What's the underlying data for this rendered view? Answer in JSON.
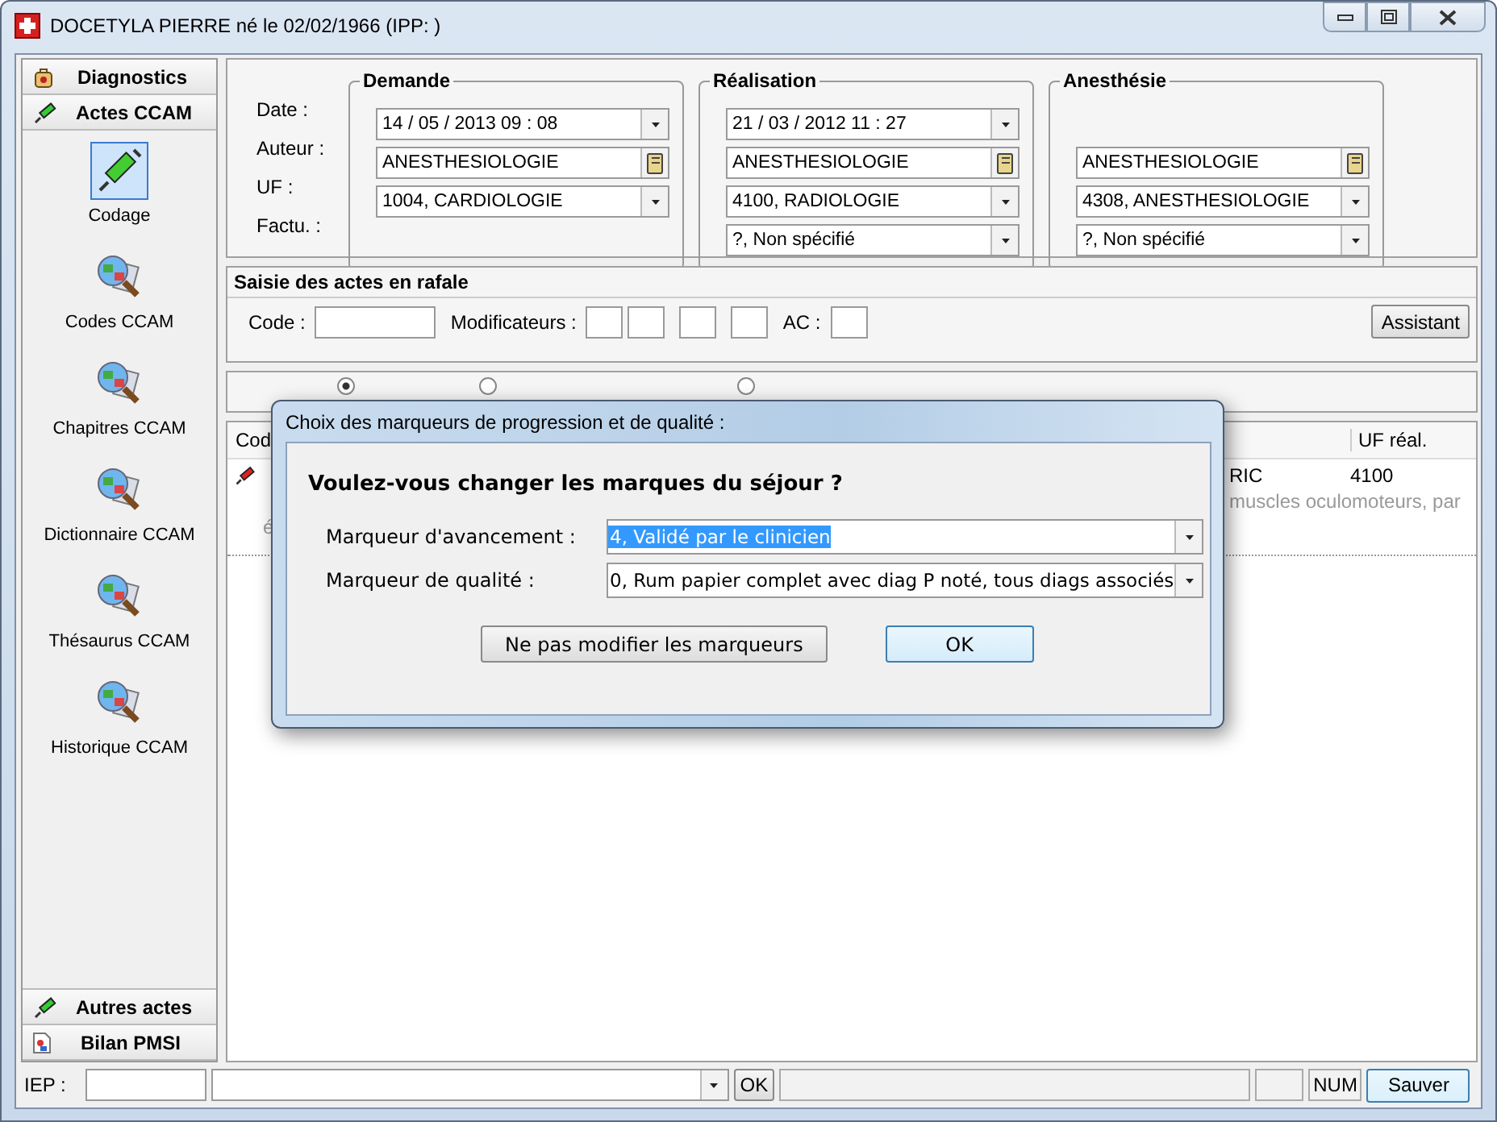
{
  "window": {
    "title": "DOCETYLA PIERRE né le 02/02/1966 (IPP: )"
  },
  "sidebar": {
    "top_items": [
      {
        "label": "Diagnostics",
        "kind": "bag"
      },
      {
        "label": "Actes CCAM",
        "kind": "syringe"
      }
    ],
    "tools": [
      {
        "label": "Codage",
        "kind": "syringe",
        "selected": true
      },
      {
        "label": "Codes CCAM",
        "kind": "magnifier",
        "selected": false
      },
      {
        "label": "Chapitres CCAM",
        "kind": "magnifier",
        "selected": false
      },
      {
        "label": "Dictionnaire CCAM",
        "kind": "magnifier",
        "selected": false
      },
      {
        "label": "Thésaurus CCAM",
        "kind": "magnifier",
        "selected": false
      },
      {
        "label": "Historique CCAM",
        "kind": "magnifier",
        "selected": false
      }
    ],
    "bottom_items": [
      {
        "label": "Autres actes",
        "kind": "syringe"
      },
      {
        "label": "Bilan PMSI",
        "kind": "document"
      }
    ]
  },
  "form": {
    "row_labels": [
      "Date :",
      "Auteur :",
      "UF :",
      "Factu. :"
    ],
    "groups": [
      {
        "title": "Demande",
        "date": {
          "kind": "dropdown",
          "value": "14 / 05 / 2013   09 : 08"
        },
        "author": {
          "kind": "lookup",
          "value": "ANESTHESIOLOGIE"
        },
        "uf": {
          "kind": "dropdown",
          "value": "1004, CARDIOLOGIE"
        }
      },
      {
        "title": "Réalisation",
        "date": {
          "kind": "dropdown",
          "value": "21 / 03 / 2012   11 : 27"
        },
        "author": {
          "kind": "lookup",
          "value": "ANESTHESIOLOGIE"
        },
        "uf": {
          "kind": "dropdown",
          "value": "4100, RADIOLOGIE"
        },
        "factu": {
          "kind": "dropdown",
          "value": "?, Non spécifié"
        }
      },
      {
        "title": "Anesthésie",
        "author": {
          "kind": "lookup",
          "value": "ANESTHESIOLOGIE"
        },
        "uf": {
          "kind": "dropdown",
          "value": "4308, ANESTHESIOLOGIE"
        },
        "factu": {
          "kind": "dropdown",
          "value": "?, Non spécifié"
        }
      }
    ]
  },
  "rafale": {
    "title": "Saisie des actes en rafale",
    "code_label": "Code :",
    "modifiers_label": "Modificateurs :",
    "ac_label": "AC :",
    "assistant_button": "Assistant"
  },
  "sort_options": [
    {
      "selected": true
    },
    {
      "selected": false
    },
    {
      "selected": false
    }
  ],
  "table": {
    "columns": [
      "Cod",
      "UF réal."
    ],
    "rows": [
      {
        "line_3": "é",
        "column_3": "RIC",
        "description": "muscles oculomoteurs, par",
        "uf": "4100"
      }
    ]
  },
  "dialog": {
    "title": "Choix des marqueurs de progression et de qualité :",
    "question": "Voulez-vous changer les marques du séjour ?",
    "fields": [
      {
        "label": "Marqueur d'avancement :",
        "value": "4, Validé par le clinicien",
        "text_selected": true
      },
      {
        "label": "Marqueur de qualité :",
        "value": "0, Rum papier complet avec diag P noté, tous diags associés",
        "text_selected": false
      }
    ],
    "buttons": [
      {
        "label": "Ne pas modifier les marqueurs",
        "default": false
      },
      {
        "label": "OK",
        "default": true
      }
    ]
  },
  "status_bar": {
    "iep_label": "IEP :",
    "ok_button": "OK",
    "num": "NUM",
    "save_button": "Sauver"
  }
}
